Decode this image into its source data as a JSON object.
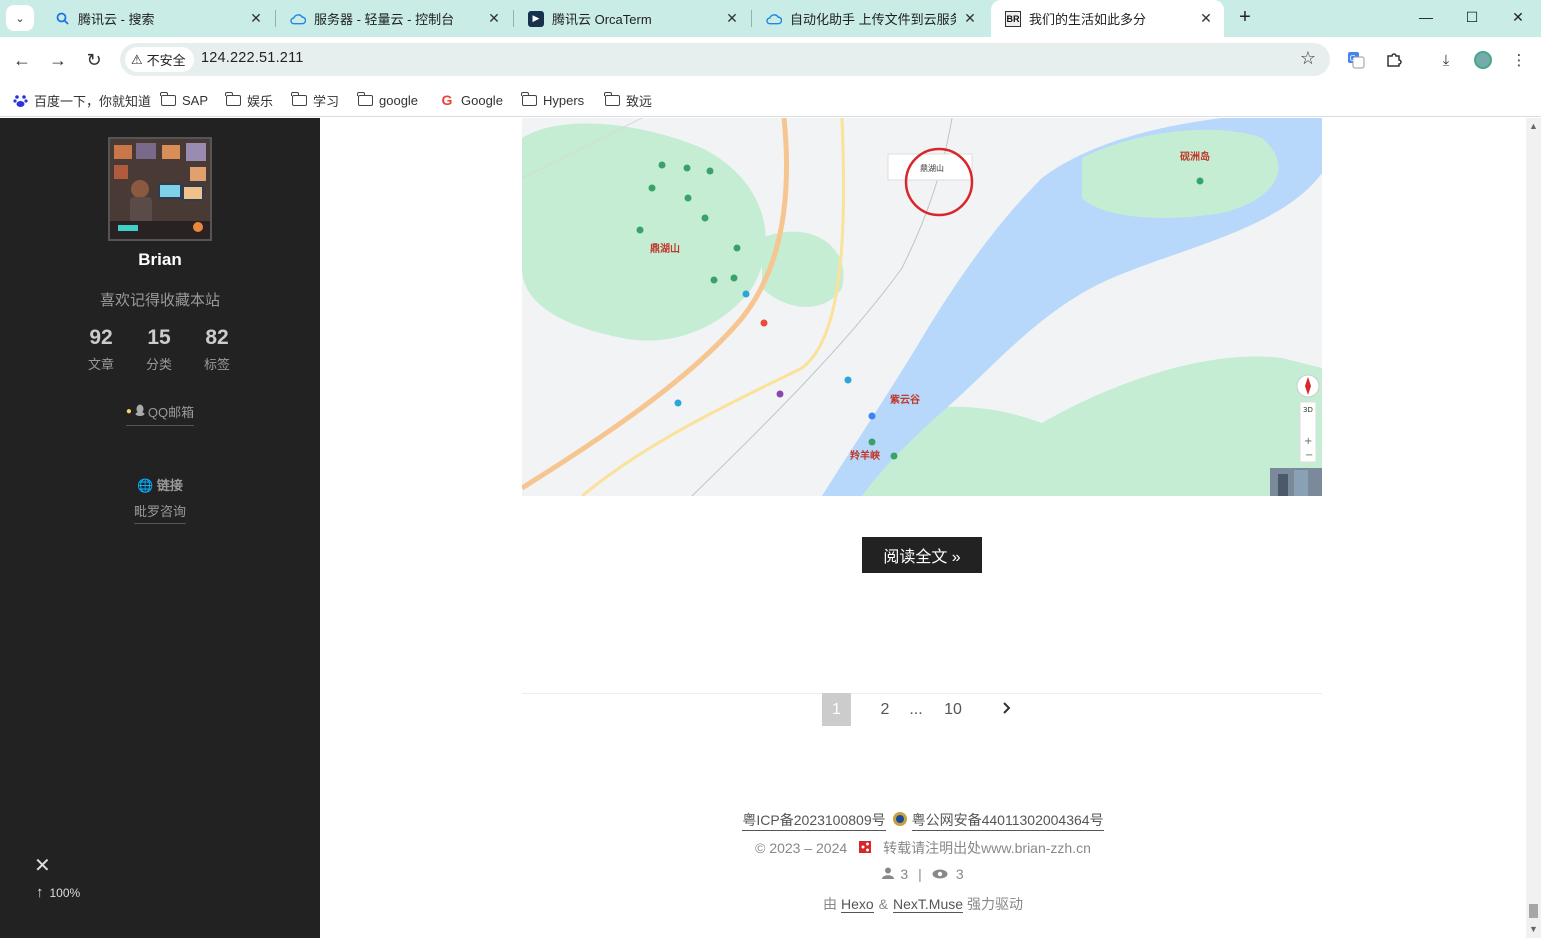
{
  "browser": {
    "tabs": [
      {
        "title": "腾讯云 - 搜索",
        "icon": "search-icon"
      },
      {
        "title": "服务器 - 轻量云 - 控制台",
        "icon": "cloud-icon"
      },
      {
        "title": "腾讯云 OrcaTerm",
        "icon": "terminal-icon"
      },
      {
        "title": "自动化助手 上传文件到云服务器",
        "icon": "cloud-icon"
      },
      {
        "title": "我们的生活如此多分",
        "icon": "br-logo-icon",
        "favicon_text": "BR"
      }
    ],
    "address": {
      "security_label": "不安全",
      "url": "124.222.51.211"
    },
    "bookmarks": [
      {
        "label": "百度一下，你就知道",
        "icon": "baidu-paw-icon"
      },
      {
        "label": "SAP",
        "icon": "folder-icon"
      },
      {
        "label": "娱乐",
        "icon": "folder-icon"
      },
      {
        "label": "学习",
        "icon": "folder-icon"
      },
      {
        "label": "google",
        "icon": "folder-icon"
      },
      {
        "label": "Google",
        "icon": "google-g-icon"
      },
      {
        "label": "Hypers",
        "icon": "folder-icon"
      },
      {
        "label": "致远",
        "icon": "folder-icon"
      }
    ]
  },
  "sidebar": {
    "author": "Brian",
    "description": "喜欢记得收藏本站",
    "stats": [
      {
        "count": "92",
        "label": "文章"
      },
      {
        "count": "15",
        "label": "分类"
      },
      {
        "count": "82",
        "label": "标签"
      }
    ],
    "social": {
      "label": "QQ邮箱",
      "icon": "qq-penguin-icon"
    },
    "links": {
      "title": "链接",
      "icon": "globe-icon",
      "items": [
        "毗罗咨询"
      ]
    },
    "back_to_top_percent": "100%"
  },
  "map": {
    "labels": {
      "dinghushan": "鼎湖山",
      "yanzhoudao": "砚洲岛",
      "ziyungu": "紫云谷",
      "lingyangxia": "羚羊峡",
      "pin_label": "鼎湖山",
      "control_3d": "3D"
    },
    "colors": {
      "water": "#b7d7fb",
      "park": "#c4edd3",
      "land": "#f1f3f5",
      "road_main": "#f6c590",
      "road_yellow": "#fbe29a",
      "highlight_circle": "#d9262b"
    }
  },
  "post": {
    "read_more": "阅读全文 »"
  },
  "pagination": {
    "current": "1",
    "pages": [
      "2",
      "...",
      "10"
    ],
    "next_icon": "chevron-right-icon"
  },
  "footer": {
    "icp": "粤ICP备2023100809号",
    "police": "粤公网安备44011302004364号",
    "copyright": "© 2023 – 2024",
    "notice": "转载请注明出处www.brian-zzh.cn",
    "visitors": "3",
    "views": "3",
    "powered_prefix": "由",
    "hexo": "Hexo",
    "amp": "&",
    "theme": "NexT.Muse",
    "powered_suffix": "强力驱动"
  }
}
